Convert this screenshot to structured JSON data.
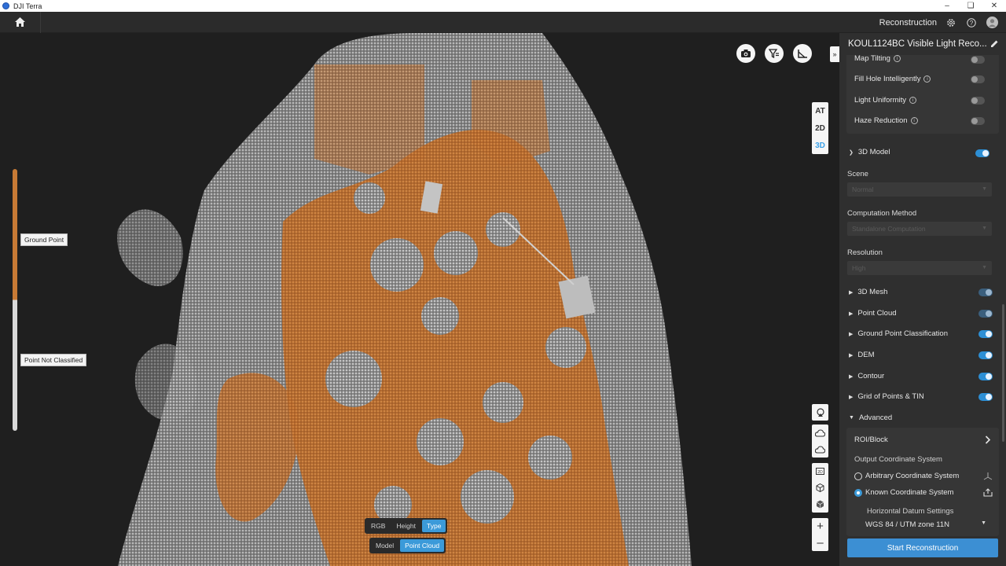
{
  "window": {
    "title": "DJI Terra"
  },
  "appbar": {
    "mode_label": "Reconstruction"
  },
  "legend": {
    "top_label": "Ground Point",
    "bottom_label": "Point Not Classified",
    "colors": {
      "ground": "#c77a35",
      "unclassified": "#d9d9d9"
    }
  },
  "view_modes": {
    "items": [
      "AT",
      "2D",
      "3D"
    ],
    "active": "3D"
  },
  "color_toggle": {
    "items": [
      "RGB",
      "Height",
      "Type"
    ],
    "active": "Type"
  },
  "display_toggle": {
    "items": [
      "Model",
      "Point Cloud"
    ],
    "active": "Point Cloud"
  },
  "panel": {
    "title": "KOUL1124BC Visible Light Reco...",
    "map_tilting": "Map Tilting",
    "fill_hole": "Fill Hole Intelligently",
    "light_uniformity": "Light Uniformity",
    "haze_reduction": "Haze Reduction",
    "model_section": "3D Model",
    "scene_label": "Scene",
    "scene_value": "Normal",
    "computation_label": "Computation Method",
    "computation_value": "Standalone Computation",
    "resolution_label": "Resolution",
    "resolution_value": "High",
    "items": [
      {
        "label": "3D Mesh",
        "state": "onmuted"
      },
      {
        "label": "Point Cloud",
        "state": "onmuted"
      },
      {
        "label": "Ground Point Classification",
        "state": "on"
      },
      {
        "label": "DEM",
        "state": "on"
      },
      {
        "label": "Contour",
        "state": "on"
      },
      {
        "label": "Grid of Points & TIN",
        "state": "on"
      }
    ],
    "advanced": "Advanced",
    "roi_block": "ROI/Block",
    "output_cs": "Output Coordinate System",
    "arbitrary_cs": "Arbitrary Coordinate System",
    "known_cs": "Known Coordinate System",
    "horizontal_datum": "Horizontal Datum Settings",
    "datum_value": "WGS 84 / UTM zone 11N",
    "start_button": "Start Reconstruction"
  }
}
